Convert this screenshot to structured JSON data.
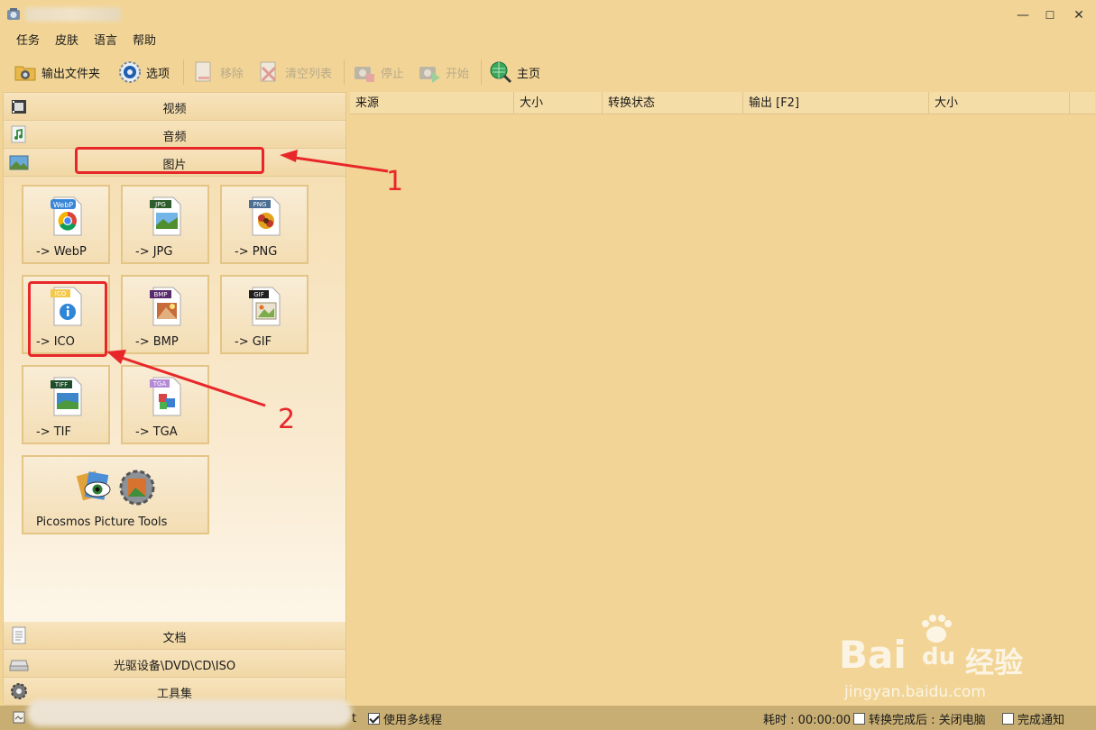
{
  "window": {
    "minimize": "—",
    "maximize": "☐",
    "close": "✕"
  },
  "menu": [
    "任务",
    "皮肤",
    "语言",
    "帮助"
  ],
  "toolbar": {
    "output_folder": "输出文件夹",
    "options": "选项",
    "remove": "移除",
    "clear_list": "清空列表",
    "stop": "停止",
    "start": "开始",
    "home": "主页"
  },
  "categories": {
    "video": "视频",
    "audio": "音频",
    "picture": "图片",
    "document": "文档",
    "disc": "光驱设备\\DVD\\CD\\ISO",
    "tools": "工具集"
  },
  "tiles": [
    {
      "label": "-> WebP",
      "badge": "WebP"
    },
    {
      "label": "-> JPG",
      "badge": "JPG"
    },
    {
      "label": "-> PNG",
      "badge": "PNG"
    },
    {
      "label": "-> ICO",
      "badge": "ICO"
    },
    {
      "label": "-> BMP",
      "badge": "BMP"
    },
    {
      "label": "-> GIF",
      "badge": "GIF"
    },
    {
      "label": "-> TIF",
      "badge": "TIFF"
    },
    {
      "label": "-> TGA",
      "badge": "TGA"
    },
    {
      "label": "Picosmos Picture Tools",
      "badge": ""
    }
  ],
  "columns": [
    "来源",
    "大小",
    "转换状态",
    "输出 [F2]",
    "大小"
  ],
  "annotations": {
    "one": "1",
    "two": "2"
  },
  "status": {
    "multithread": "使用多线程",
    "elapsed": "耗时 : 00:00:00",
    "after_done": "转换完成后 : 关闭电脑",
    "notify": "完成通知",
    "stray_char": "t"
  },
  "watermark": {
    "brand": "Bai",
    "du": "du",
    "jingyan": "经验",
    "url": "jingyan.baidu.com"
  },
  "colors": {
    "background": "#f2d596",
    "annotation_red": "#e8272a"
  }
}
